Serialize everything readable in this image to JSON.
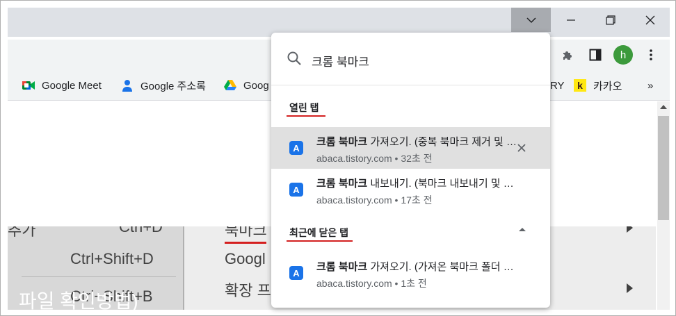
{
  "bookmarks": [
    {
      "label": "Google Meet",
      "icon": "google-meet-icon"
    },
    {
      "label": "Google 주소록",
      "icon": "person-icon"
    },
    {
      "label": "Goog",
      "icon": "google-drive-icon"
    },
    {
      "label": "RY",
      "icon": ""
    },
    {
      "label": "카카오",
      "icon": "kakao-icon",
      "icon_text": "k"
    }
  ],
  "bookmarks_overflow": "»",
  "avatar_letter": "h",
  "background_menu": {
    "col1": [
      "추가",
      "Ctrl+D",
      "Ctrl+Shift+D",
      "Ctrl+Shift+B"
    ],
    "col2": [
      "북마크",
      "Googl",
      "확장 프"
    ],
    "overlay": "파일 확인방법)"
  },
  "popup": {
    "search_value": "크롬 북마크",
    "sections": {
      "open_tabs": {
        "title": "열린 탭",
        "items": [
          {
            "title_bold": "크롬 북마크",
            "title_rest": " 가져오기. (중복 북마크 제거 및 정리)",
            "url": "abaca.tistory.com",
            "time": "32초 전",
            "highlighted": true
          },
          {
            "title_bold": "크롬 북마크",
            "title_rest": " 내보내기. (북마크 내보내기 및 저장)",
            "url": "abaca.tistory.com",
            "time": "17초 전",
            "highlighted": false
          }
        ]
      },
      "recently_closed": {
        "title": "최근에 닫은 탭",
        "items": [
          {
            "title_bold": "크롬 북마크",
            "title_rest": " 가져오기. (가져온 북마크 폴더 정리)",
            "url": "abaca.tistory.com",
            "time": "1초 전",
            "highlighted": false
          }
        ]
      }
    },
    "favicon_letter": "A",
    "separator": " • "
  },
  "colors": {
    "accent_red": "#d32020",
    "favicon_blue": "#1a73e8",
    "avatar_green": "#3c9a3c"
  }
}
